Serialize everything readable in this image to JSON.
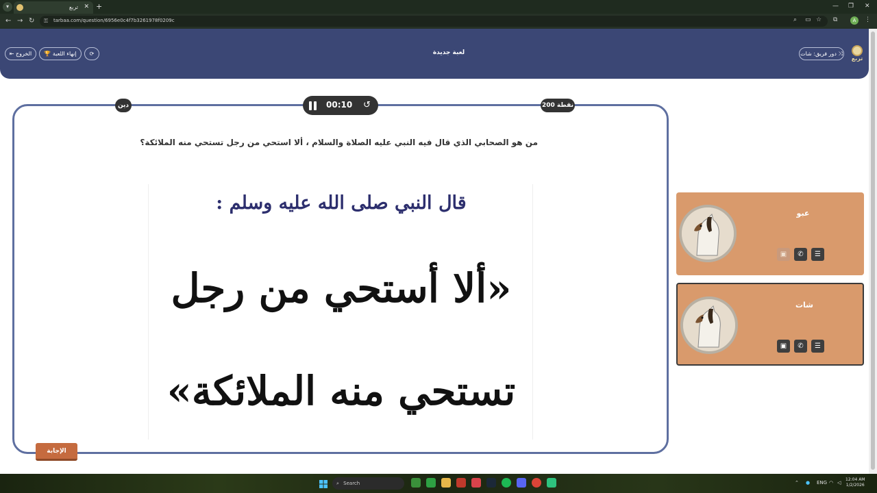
{
  "browser": {
    "tab_title": "تربع",
    "url": "tarbaa.com/question/6956e0c4f7b3261978f0209c",
    "profile_initial": "A"
  },
  "header": {
    "title": "لعبة جديدة",
    "exit_label": "الخروج",
    "end_game_label": "إنهاء اللعبة",
    "turn_label": "دور فريق: شات",
    "logo_text": "تربع"
  },
  "question_card": {
    "category": "دين",
    "points": "200 نقطة",
    "timer": "00:10",
    "question": "من هو الصحابي الذي قال فيه النبي عليه الصلاة والسلام ، ألا استحي من رجل تستحي منه الملائكة؟",
    "image_line1": "قال النبي صلى الله عليه وسلم :",
    "image_line2": "«ألا أستحي من رجل",
    "image_line3": "تستحي منه الملائكة»",
    "answer_label": "الإجابة"
  },
  "teams": [
    {
      "name": "عبو",
      "active": false
    },
    {
      "name": "شات",
      "active": true
    }
  ],
  "taskbar": {
    "search_label": "Search",
    "language": "ENG",
    "time": "12:04 AM",
    "date": "1/2/2026"
  },
  "icons": [
    "chevron-down-icon",
    "close-icon",
    "plus-icon",
    "back-icon",
    "forward-icon",
    "reload-icon",
    "lock-icon",
    "search-icon",
    "star-icon",
    "extensions-icon",
    "more-icon",
    "logout-icon",
    "trophy-icon",
    "refresh-icon",
    "shuffle-icon",
    "pause-icon",
    "history-icon",
    "list-icon",
    "phone-icon",
    "camera-icon",
    "windows-icon"
  ]
}
